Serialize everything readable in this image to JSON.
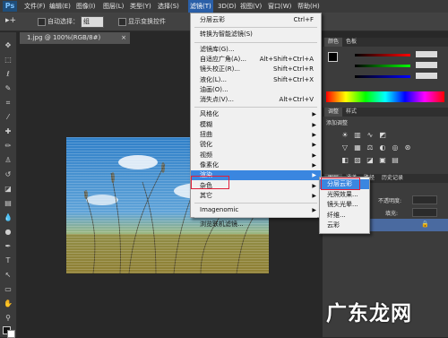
{
  "app": {
    "logo": "Ps"
  },
  "menubar": {
    "items": [
      "文件(F)",
      "编辑(E)",
      "图像(I)",
      "图层(L)",
      "类型(Y)",
      "选择(S)",
      "滤镜(T)",
      "3D(D)",
      "视图(V)",
      "窗口(W)",
      "帮助(H)"
    ],
    "active_index": 6
  },
  "options": {
    "feather_label": "自动选择：",
    "group_value": "组",
    "transform_label": "显示变换控件"
  },
  "document": {
    "tab_label": "1.jpg @ 100%(RGB/8#)",
    "close": "×"
  },
  "filter_menu": {
    "items": [
      {
        "label": "分层云彩",
        "shortcut": "Ctrl+F"
      },
      {
        "separator": true
      },
      {
        "label": "转换为智能滤镜(S)"
      },
      {
        "separator": true
      },
      {
        "label": "滤镜库(G)..."
      },
      {
        "label": "自适应广角(A)...",
        "shortcut": "Alt+Shift+Ctrl+A"
      },
      {
        "label": "镜头校正(R)...",
        "shortcut": "Shift+Ctrl+R"
      },
      {
        "label": "液化(L)...",
        "shortcut": "Shift+Ctrl+X"
      },
      {
        "label": "油画(O)..."
      },
      {
        "label": "消失点(V)...",
        "shortcut": "Alt+Ctrl+V"
      },
      {
        "separator": true
      },
      {
        "label": "风格化",
        "submenu": true
      },
      {
        "label": "模糊",
        "submenu": true
      },
      {
        "label": "扭曲",
        "submenu": true
      },
      {
        "label": "锐化",
        "submenu": true
      },
      {
        "label": "视频",
        "submenu": true
      },
      {
        "label": "像素化",
        "submenu": true
      },
      {
        "label": "渲染",
        "submenu": true,
        "highlighted": true
      },
      {
        "label": "杂色",
        "submenu": true
      },
      {
        "label": "其它",
        "submenu": true
      },
      {
        "separator": true
      },
      {
        "label": "Imagenomic",
        "submenu": true
      },
      {
        "separator": true
      },
      {
        "label": "浏览联机滤镜..."
      }
    ]
  },
  "render_submenu": {
    "items": [
      "分层云彩",
      "光照效果...",
      "镜头光晕...",
      "纤维...",
      "云彩"
    ],
    "highlighted_index": 0
  },
  "panels": {
    "color_tabs": [
      "颜色",
      "色板"
    ],
    "adjust_tabs": [
      "调整",
      "样式"
    ],
    "adjust_title": "添加调整",
    "layer_tabs": [
      "图层",
      "通道",
      "路径",
      "历史记录"
    ],
    "opacity_label": "不透明度:",
    "fill_label": "填充:",
    "layer_name": "背景"
  },
  "colors": {
    "accent": "#3a86e0",
    "menubar": "#3a3a3a",
    "highlight_box": "#e0203a"
  },
  "watermark": {
    "text": "广东龙网"
  }
}
